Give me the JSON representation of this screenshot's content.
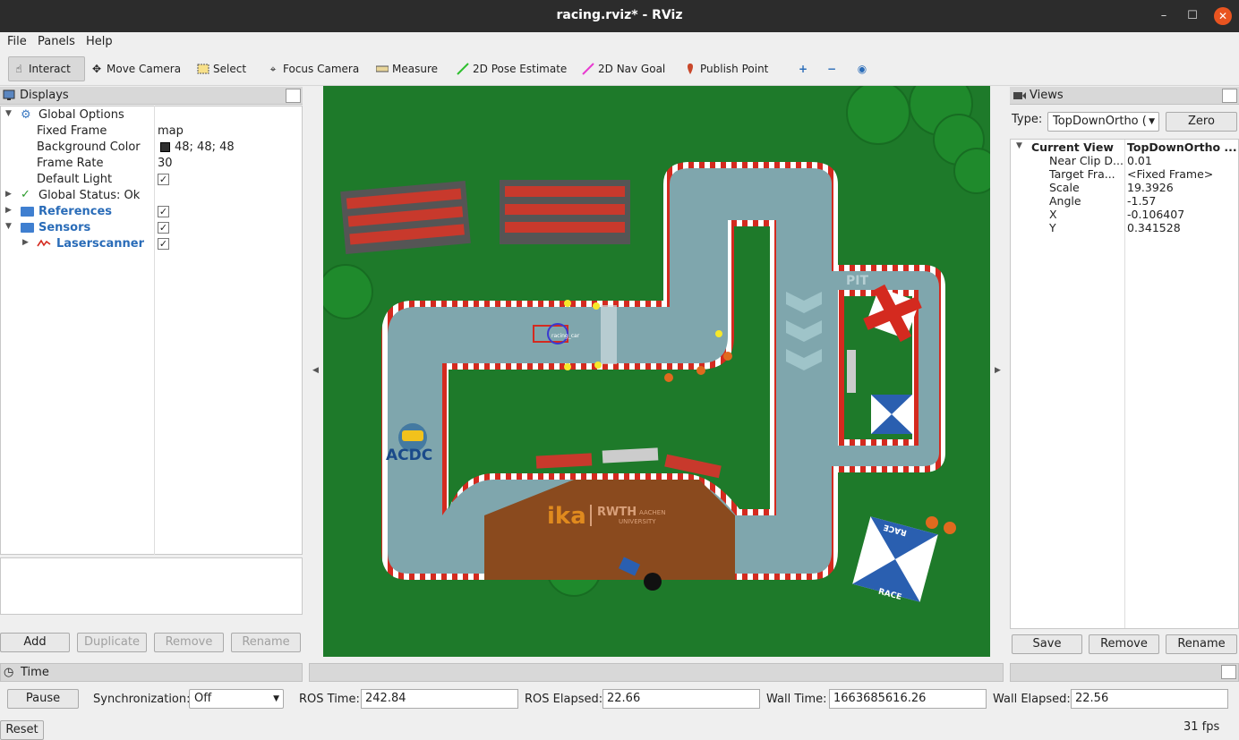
{
  "window": {
    "title": "racing.rviz* - RViz",
    "minimize": "–",
    "maximize": "☐",
    "close": "✕"
  },
  "menu": {
    "file": "File",
    "panels": "Panels",
    "help": "Help"
  },
  "toolbar": {
    "interact": "Interact",
    "move_camera": "Move Camera",
    "select": "Select",
    "focus_camera": "Focus Camera",
    "measure": "Measure",
    "pose_estimate": "2D Pose Estimate",
    "nav_goal": "2D Nav Goal",
    "publish_point": "Publish Point"
  },
  "displays": {
    "title": "Displays",
    "rows": {
      "global_options": "Global Options",
      "fixed_frame_label": "Fixed Frame",
      "fixed_frame_value": "map",
      "bg_color_label": "Background Color",
      "bg_color_value": "48; 48; 48",
      "frame_rate_label": "Frame Rate",
      "frame_rate_value": "30",
      "default_light_label": "Default Light",
      "global_status": "Global Status: Ok",
      "references": "References",
      "sensors": "Sensors",
      "laserscanner": "Laserscanner"
    },
    "buttons": {
      "add": "Add",
      "duplicate": "Duplicate",
      "remove": "Remove",
      "rename": "Rename"
    }
  },
  "map": {
    "acdc": "ACDC",
    "ika": "ika",
    "rwth": "RWTH",
    "rwth_sub1": "AACHEN",
    "rwth_sub2": "UNIVERSITY",
    "pit": "PIT",
    "race": "RACE",
    "car_label": "racing_car"
  },
  "views": {
    "title": "Views",
    "type_label": "Type:",
    "type_value": "TopDownOrtho (",
    "zero": "Zero",
    "current_view": "Current View",
    "current_view_type": "TopDownOrtho ...",
    "props": [
      {
        "label": "Near Clip D...",
        "value": "0.01"
      },
      {
        "label": "Target Fra...",
        "value": "<Fixed Frame>"
      },
      {
        "label": "Scale",
        "value": "19.3926"
      },
      {
        "label": "Angle",
        "value": "-1.57"
      },
      {
        "label": "X",
        "value": "-0.106407"
      },
      {
        "label": "Y",
        "value": "0.341528"
      }
    ],
    "buttons": {
      "save": "Save",
      "remove": "Remove",
      "rename": "Rename"
    }
  },
  "time": {
    "title": "Time",
    "pause": "Pause",
    "sync_label": "Synchronization:",
    "sync_value": "Off",
    "ros_time_label": "ROS Time:",
    "ros_time": "242.84",
    "ros_elapsed_label": "ROS Elapsed:",
    "ros_elapsed": "22.66",
    "wall_time_label": "Wall Time:",
    "wall_time": "1663685616.26",
    "wall_elapsed_label": "Wall Elapsed:",
    "wall_elapsed": "22.56",
    "reset": "Reset",
    "fps": "31 fps"
  },
  "colors": {
    "track": "#7fa6ad",
    "grass": "#1e7a2a",
    "curb_red": "#d42a1f",
    "ika_orange": "#e08a1e",
    "accent_blue": "#2a6cb8"
  }
}
